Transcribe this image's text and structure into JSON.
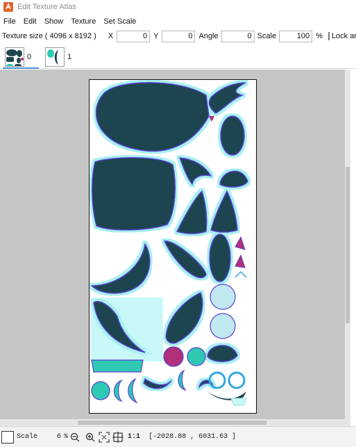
{
  "window": {
    "title": "Edit Texture Atlas"
  },
  "menu": [
    "File",
    "Edit",
    "Show",
    "Texture",
    "Set Scale"
  ],
  "toolbar": {
    "texture_size_label": "Texture size ( 4096 x 8192 )",
    "x_label": "X",
    "x_value": "0",
    "y_label": "Y",
    "y_value": "0",
    "angle_label": "Angle",
    "angle_value": "0",
    "scale_label": "Scale",
    "scale_value": "100",
    "percent": "%",
    "lock_angle_label": "Lock angle",
    "lock_angle_checked": false
  },
  "tabs": [
    {
      "label": "0",
      "active": true
    },
    {
      "label": "1",
      "active": false
    }
  ],
  "status": {
    "scale_label": "Scale",
    "zoom_value": "6",
    "zoom_unit": "%",
    "one_to_one": "1:1",
    "coordinates": "[-2028.88 , 6031.63 ]"
  },
  "colors": {
    "shape_fill": "#1f4550",
    "outline": "#5a3fd6",
    "glow": "#a8f0f0",
    "magenta": "#b0307a",
    "accent": "#4a90d9",
    "icon_orange": "#e2622a"
  }
}
